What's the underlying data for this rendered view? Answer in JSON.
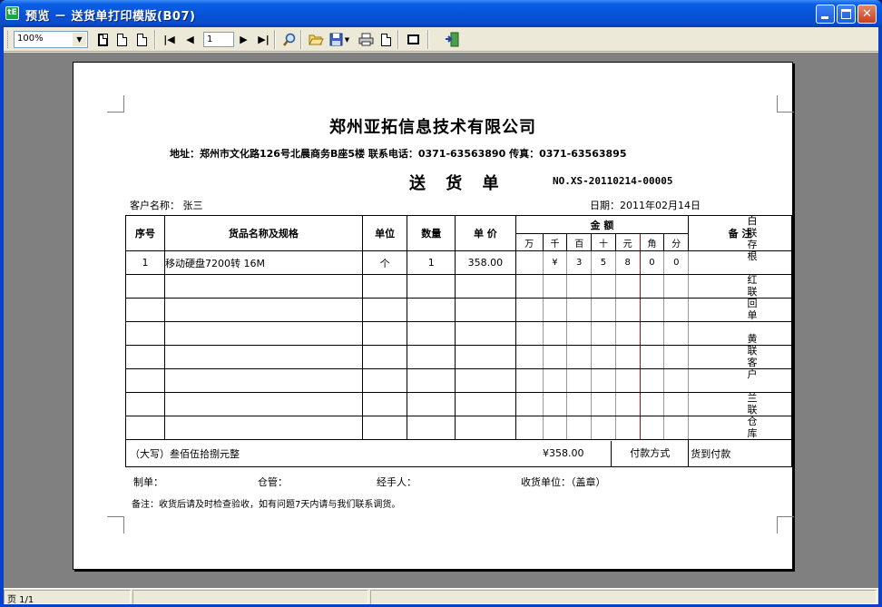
{
  "window": {
    "title": "预览 － 送货单打印模版(B07)",
    "icon_label": "tE"
  },
  "toolbar": {
    "zoom_value": "100%",
    "page_value": "1",
    "icons": [
      "whole-page-icon",
      "page-width-icon",
      "two-pages-icon",
      "first-page-icon",
      "prev-page-icon",
      "next-page-icon",
      "last-page-icon",
      "zoom-icon",
      "open-icon",
      "save-icon",
      "print-icon",
      "page-setup-icon",
      "design-icon",
      "exit-icon"
    ]
  },
  "document": {
    "company": "郑州亚拓信息技术有限公司",
    "address": "地址：郑州市文化路126号北晨商务B座5楼   联系电话：0371-63563890   传真：0371-63563895",
    "title": "送 货 单",
    "doc_no": "NO.XS-20110214-00005",
    "customer_label": "客户名称：",
    "customer": "张三",
    "date_label": "日期：",
    "date": "2011年02月14日",
    "headers": {
      "seq": "序号",
      "name": "货品名称及规格",
      "unit": "单位",
      "qty": "数量",
      "price": "单 价",
      "amount": "金 额",
      "remark": "备 注",
      "digits": [
        "万",
        "千",
        "百",
        "十",
        "元",
        "角",
        "分"
      ]
    },
    "rows": [
      {
        "seq": "1",
        "name": "移动硬盘7200转 16M",
        "unit": "个",
        "qty": "1",
        "price": "358.00",
        "digits": [
          "",
          "¥",
          "3",
          "5",
          "8",
          "0",
          "0"
        ],
        "remark": ""
      }
    ],
    "empty_rows": 7,
    "total_words": "（大写）叁佰伍拾捌元整",
    "total_amount": "¥358.00",
    "payment_label": "付款方式",
    "payment": "货到付款",
    "copies": [
      "白联存根",
      "红联回单",
      "黄联客户",
      "兰联仓库"
    ],
    "signatures": {
      "maker": "制单：",
      "warehouse": "仓管：",
      "handler": "经手人：",
      "receiver": "收货单位：（盖章）"
    },
    "note": "备注：收货后请及时检查验收，如有问题7天内请与我们联系调货。"
  },
  "status": {
    "page": "页 1/1"
  }
}
